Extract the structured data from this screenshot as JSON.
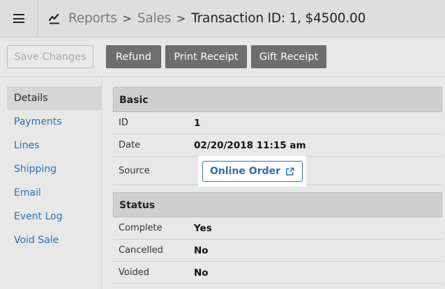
{
  "header": {
    "breadcrumb_reports": "Reports",
    "breadcrumb_sales": "Sales",
    "breadcrumb_current": "Transaction ID: 1, $4500.00",
    "separator": ">"
  },
  "toolbar": {
    "save_label": "Save Changes",
    "refund_label": "Refund",
    "print_label": "Print Receipt",
    "gift_label": "Gift Receipt"
  },
  "sidebar": {
    "items": [
      {
        "label": "Details"
      },
      {
        "label": "Payments"
      },
      {
        "label": "Lines"
      },
      {
        "label": "Shipping"
      },
      {
        "label": "Email"
      },
      {
        "label": "Event Log"
      },
      {
        "label": "Void Sale"
      }
    ]
  },
  "basic": {
    "title": "Basic",
    "id_label": "ID",
    "id_value": "1",
    "date_label": "Date",
    "date_value": "02/20/2018 11:15 am",
    "source_label": "Source",
    "source_button": "Online Order"
  },
  "status": {
    "title": "Status",
    "complete_label": "Complete",
    "complete_value": "Yes",
    "cancelled_label": "Cancelled",
    "cancelled_value": "No",
    "voided_label": "Voided",
    "voided_value": "No"
  },
  "icons": {
    "menu": "hamburger-menu-icon",
    "reports": "line-chart-icon",
    "external": "external-link-icon"
  },
  "colors": {
    "link": "#2f6fae",
    "button_dark": "#6e6e6e"
  }
}
